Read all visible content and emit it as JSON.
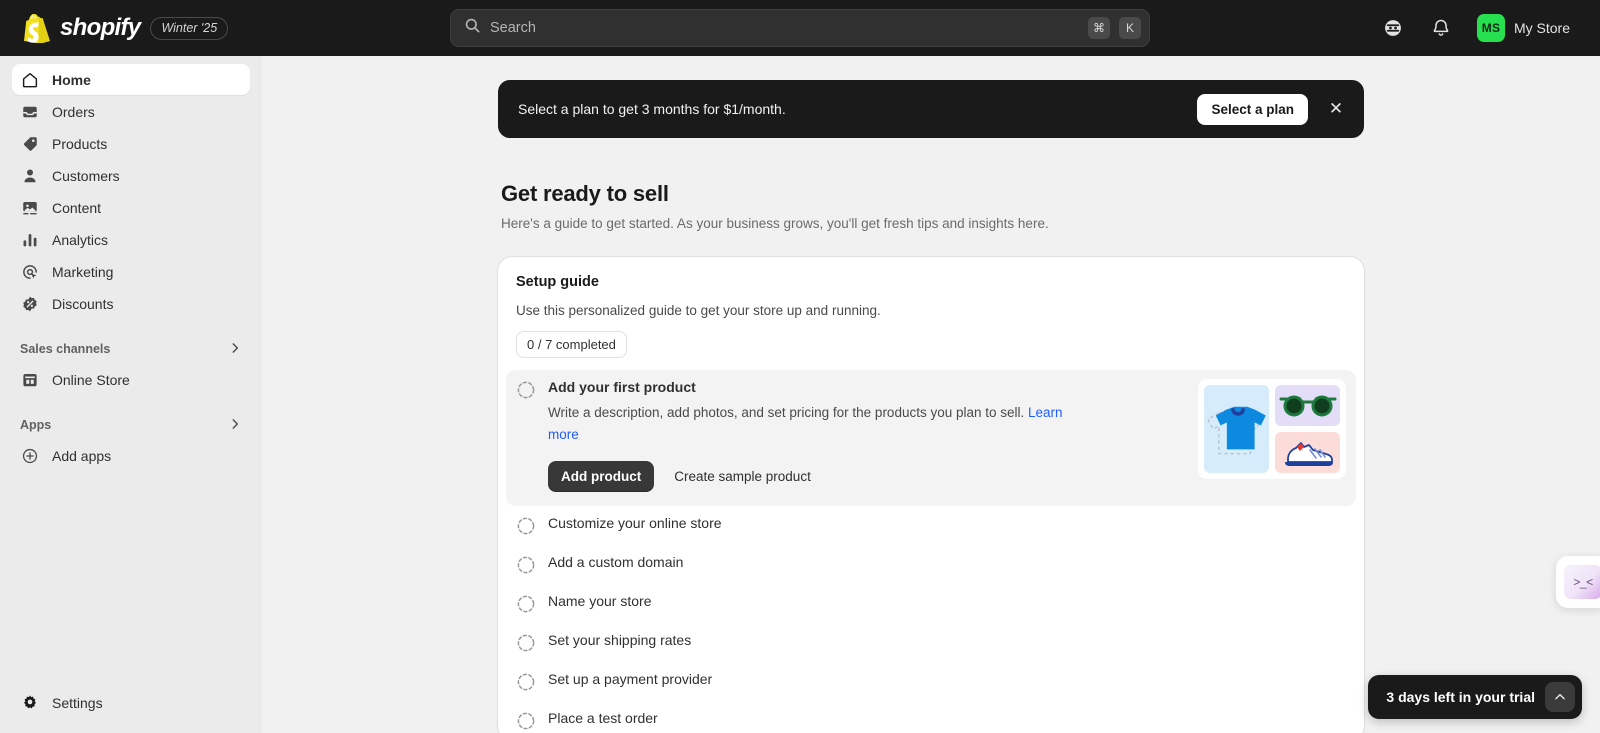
{
  "topbar": {
    "brand_name": "shopify",
    "version_badge": "Winter '25",
    "search": {
      "placeholder": "Search",
      "shortcut_modifier": "⌘",
      "shortcut_key": "K"
    },
    "help_icon": "support-bot-icon",
    "notifications_icon": "bell-icon",
    "avatar_initials": "MS",
    "store_name": "My Store"
  },
  "sidebar": {
    "items": [
      {
        "label": "Home",
        "icon": "home-icon",
        "active": true
      },
      {
        "label": "Orders",
        "icon": "orders-inbox-icon",
        "active": false
      },
      {
        "label": "Products",
        "icon": "product-tag-icon",
        "active": false
      },
      {
        "label": "Customers",
        "icon": "person-icon",
        "active": false
      },
      {
        "label": "Content",
        "icon": "content-image-icon",
        "active": false
      },
      {
        "label": "Analytics",
        "icon": "bar-chart-icon",
        "active": false
      },
      {
        "label": "Marketing",
        "icon": "marketing-target-icon",
        "active": false
      },
      {
        "label": "Discounts",
        "icon": "discount-badge-icon",
        "active": false
      }
    ],
    "sales_channels": {
      "label": "Sales channels",
      "chevron": "›",
      "items": [
        {
          "label": "Online Store",
          "icon": "storefront-icon"
        }
      ]
    },
    "apps": {
      "label": "Apps",
      "chevron": "›",
      "items": [
        {
          "label": "Add apps",
          "icon": "plus-circle-icon"
        }
      ]
    },
    "settings": {
      "label": "Settings",
      "icon": "gear-icon"
    }
  },
  "banner": {
    "message": "Select a plan to get 3 months for $1/month.",
    "button_label": "Select a plan",
    "close_label": "✕"
  },
  "page": {
    "title": "Get ready to sell",
    "subtitle": "Here's a guide to get started. As your business grows, you'll get fresh tips and insights here."
  },
  "setup_guide": {
    "title": "Setup guide",
    "subtitle": "Use this personalized guide to get your store up and running.",
    "progress_badge": "0 / 7 completed",
    "completed_count": 0,
    "total_count": 7,
    "tasks": [
      {
        "title": "Add your first product",
        "expanded": true,
        "description": "Write a description, add photos, and set pricing for the products you plan to sell. ",
        "link_label": "Learn more",
        "primary_action": "Add product",
        "secondary_action": "Create sample product"
      },
      {
        "title": "Customize your online store",
        "expanded": false
      },
      {
        "title": "Add a custom domain",
        "expanded": false
      },
      {
        "title": "Name your store",
        "expanded": false
      },
      {
        "title": "Set your shipping rates",
        "expanded": false
      },
      {
        "title": "Set up a payment provider",
        "expanded": false
      },
      {
        "title": "Place a test order",
        "expanded": false
      }
    ]
  },
  "trial": {
    "text": "3 days left in your trial",
    "toggle_icon": "chevron-up-icon"
  },
  "chat_widget": {
    "face": ">_<"
  },
  "colors": {
    "brand_green": "#27e04f",
    "topbar_bg": "#1a1a1a",
    "sidebar_bg": "#ebebeb",
    "page_bg": "#f1f1f1",
    "link_blue": "#1f5eff"
  }
}
